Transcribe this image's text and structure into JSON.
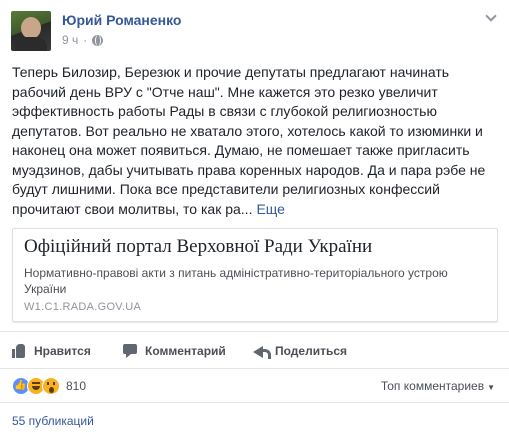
{
  "post": {
    "author": "Юрий Романенко",
    "time": "9 ч",
    "separator": "·",
    "text": "Теперь Билозир, Березюк и прочие депутаты предлагают начинать рабочий день ВРУ с \"Отче наш\". Мне кажется это резко увеличит эффективность работы Рады в связи с глубокой религиозностью депутатов. Вот реально не хватало этого, хотелось какой то изюминки и наконец она может появиться. Думаю, не помешает также пригласить муэдзинов, дабы учитывать права коренных народов. Да и пара рэбе не будут лишними. Пока все представители религиозных конфессий прочитают свои молитвы, то как ра...",
    "see_more": "Еще"
  },
  "link_card": {
    "title": "Офіційний портал Верховної Ради України",
    "description": "Нормативно-правові акти з питань адміністративно-територіального устрою України",
    "domain": "W1.C1.RADA.GOV.UA"
  },
  "actions": {
    "like": "Нравится",
    "comment": "Комментарий",
    "share": "Поделиться"
  },
  "reactions": {
    "count": "810",
    "sort_label": "Топ комментариев",
    "sort_caret": "▼"
  },
  "shares": {
    "label": "55 публикаций"
  },
  "icons": [
    "globe-icon",
    "chevron-down-icon",
    "thumb-up-icon",
    "comment-icon",
    "share-icon"
  ],
  "colors": {
    "link": "#365899",
    "text": "#1d2129",
    "muted": "#90949c",
    "like_reaction": "#5890ff",
    "emoji_reaction": "#f7b125"
  }
}
